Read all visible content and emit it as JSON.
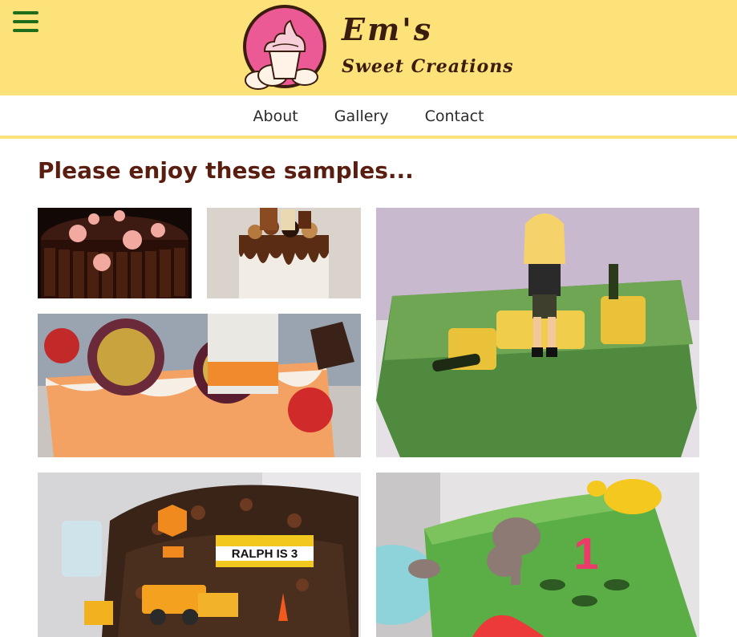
{
  "header": {
    "brand_line1": "Em's",
    "brand_line2": "Sweet Creations",
    "menu_icon": "hamburger-icon",
    "colors": {
      "background": "#fde27a",
      "menu": "#1f6d1c",
      "brand_text": "#3a1d0e",
      "logo_circle": "#ec5a96"
    }
  },
  "nav": {
    "items": [
      {
        "label": "About"
      },
      {
        "label": "Gallery"
      },
      {
        "label": "Contact"
      }
    ]
  },
  "main": {
    "title": "Please enjoy these samples...",
    "title_color": "#5a1e10",
    "gallery": [
      {
        "subject": "chocolate pigs cake"
      },
      {
        "subject": "chocolate drip cake"
      },
      {
        "subject": "field bales figure cake"
      },
      {
        "subject": "passion fruit martini cake"
      },
      {
        "subject": "construction site cake with RALPH IS 3 sign",
        "sign_text": "RALPH IS 3"
      },
      {
        "subject": "jungle animal number one cake",
        "number_text": "1"
      }
    ]
  }
}
